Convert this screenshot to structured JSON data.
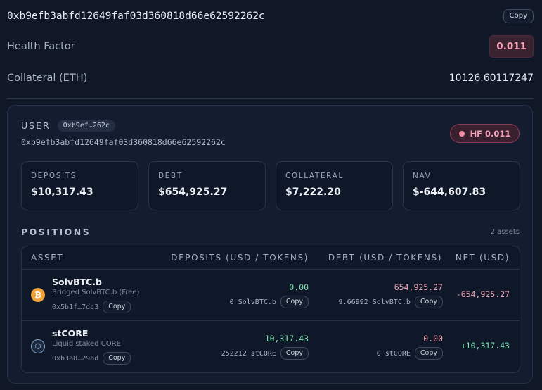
{
  "summary": {
    "address": "0xb9efb3abfd12649faf03d360818d66e62592262c",
    "copy_label": "Copy",
    "health_factor_label": "Health Factor",
    "health_factor_value": "0.011",
    "collateral_label": "Collateral (ETH)",
    "collateral_value": "10126.60117247"
  },
  "user": {
    "label": "USER",
    "short_address": "0xb9ef…262c",
    "full_address": "0xb9efb3abfd12649faf03d360818d66e62592262c",
    "hf_badge": "HF 0.011"
  },
  "stats": [
    {
      "label": "DEPOSITS",
      "value": "$10,317.43"
    },
    {
      "label": "DEBT",
      "value": "$654,925.27"
    },
    {
      "label": "COLLATERAL",
      "value": "$7,222.20"
    },
    {
      "label": "NAV",
      "value": "$-644,607.83"
    }
  ],
  "positions": {
    "title": "POSITIONS",
    "count": "2 assets",
    "columns": {
      "asset": "ASSET",
      "deposits": "DEPOSITS (USD / TOKENS)",
      "debt": "DEBT (USD / TOKENS)",
      "net": "NET (USD)"
    },
    "rows": [
      {
        "icon": "bitcoin-icon",
        "name": "SolvBTC.b",
        "subtitle": "Bridged SolvBTC.b (Free)",
        "address": "0x5b1f…7dc3",
        "deposit_usd": "0.00",
        "deposit_tokens": "0 SolvBTC.b",
        "debt_usd": "654,925.27",
        "debt_tokens": "9.66992 SolvBTC.b",
        "net": "-654,925.27"
      },
      {
        "icon": "core-icon",
        "name": "stCORE",
        "subtitle": "Liquid staked CORE",
        "address": "0xb3a8…29ad",
        "deposit_usd": "10,317.43",
        "deposit_tokens": "252212 stCORE",
        "debt_usd": "0.00",
        "debt_tokens": "0 stCORE",
        "net": "+10,317.43"
      }
    ]
  },
  "colors": {
    "background": "#101828",
    "positive": "#7fe0b0",
    "negative": "#f2a2b4",
    "danger_badge": "#3a1f2f"
  }
}
